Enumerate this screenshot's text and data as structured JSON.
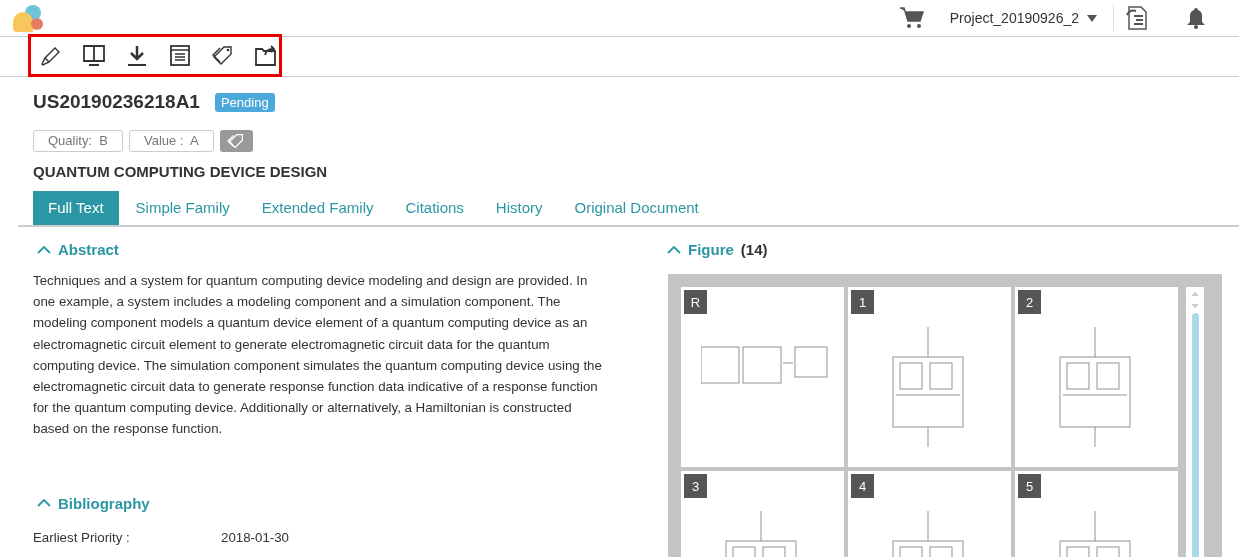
{
  "header": {
    "project": "Project_20190926_2"
  },
  "toolbar": {
    "highlighted": true,
    "tools": [
      {
        "kind": "highlighter"
      },
      {
        "kind": "split"
      },
      {
        "kind": "download"
      },
      {
        "kind": "list"
      },
      {
        "kind": "tag"
      },
      {
        "kind": "export"
      }
    ]
  },
  "patent": {
    "number": "US20190236218A1",
    "status": "Pending",
    "ratings": [
      "Quality:  B",
      "Value :  A"
    ],
    "title": "QUANTUM COMPUTING DEVICE DESIGN"
  },
  "tabs": [
    {
      "label": "Full Text",
      "selected": true
    },
    {
      "label": "Simple Family",
      "selected": false
    },
    {
      "label": "Extended Family",
      "selected": false
    },
    {
      "label": "Citations",
      "selected": false
    },
    {
      "label": "History",
      "selected": false
    },
    {
      "label": "Original Document",
      "selected": false
    }
  ],
  "abstract": {
    "heading": "Abstract",
    "expanded": true,
    "text": "Techniques and a system for quantum computing device modeling and design are provided. In one example, a system includes a modeling component and a simulation component. The modeling component models a quantum device element of a quantum computing device as an electromagnetic circuit element to generate electromagnetic circuit data for the quantum computing device. The simulation component simulates the quantum computing device using the electromagnetic circuit data to generate response function data indicative of a response function for the quantum computing device. Additionally or alternatively, a Hamiltonian is constructed based on the response function."
  },
  "bibliography": {
    "heading": "Bibliography",
    "expanded": true,
    "rows": [
      {
        "label": "Earliest Priority :",
        "value": "2018-01-30"
      }
    ]
  },
  "figures": {
    "heading": "Figure",
    "count": "(14)",
    "expanded": true,
    "items": [
      {
        "label": "R"
      },
      {
        "label": "1"
      },
      {
        "label": "2"
      },
      {
        "label": "3"
      },
      {
        "label": "4"
      },
      {
        "label": "5"
      }
    ]
  }
}
